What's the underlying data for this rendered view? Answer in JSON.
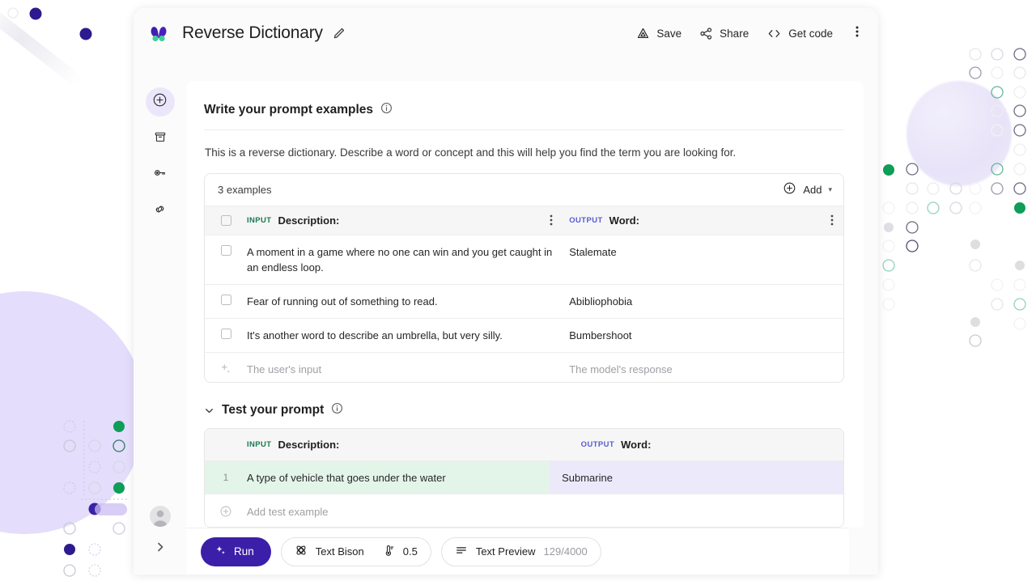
{
  "app": {
    "logo_icon": "butterfly-logo",
    "title": "Reverse Dictionary",
    "edit_icon": "pencil-icon"
  },
  "topbar": {
    "actions": [
      {
        "label": "Save",
        "icon": "drive-save-icon"
      },
      {
        "label": "Share",
        "icon": "share-icon"
      },
      {
        "label": "Get code",
        "icon": "code-brackets-icon"
      }
    ],
    "overflow_icon": "more-vertical-icon"
  },
  "sidebar": {
    "items": [
      {
        "name": "create-new-prompt",
        "icon": "plus-circle-icon",
        "active": true
      },
      {
        "name": "saved-prompts",
        "icon": "archive-box-icon",
        "active": false
      },
      {
        "name": "api-key",
        "icon": "key-icon",
        "active": false
      },
      {
        "name": "links",
        "icon": "link-icon",
        "active": false
      }
    ],
    "avatar_icon": "user-avatar",
    "expand_icon": "chevron-right-icon"
  },
  "prompt_section": {
    "title": "Write your prompt examples",
    "info_icon": "info-icon",
    "description": "This is a reverse dictionary. Describe a word or concept and this will help you find the term you are looking for.",
    "examples_count_label": "3 examples",
    "add_label": "Add",
    "add_icon": "plus-circle-icon",
    "add_caret_icon": "caret-down-icon",
    "columns": {
      "input_tag": "INPUT",
      "input_label": "Description:",
      "output_tag": "OUTPUT",
      "output_label": "Word:"
    },
    "rows": [
      {
        "input": "A moment in a game where no one can win and you get caught in an endless loop.",
        "output": "Stalemate"
      },
      {
        "input": "Fear of running out of something to read.",
        "output": "Abibliophobia"
      },
      {
        "input": "It's another word to describe an umbrella, but very silly.",
        "output": "Bumbershoot"
      }
    ],
    "placeholder_row": {
      "icon": "sparkle-add-icon",
      "input": "The user's input",
      "output": "The model's response"
    },
    "row_menu_icon": "more-vertical-icon",
    "checkbox_icon": "checkbox-unchecked"
  },
  "test_section": {
    "collapse_icon": "chevron-down-icon",
    "title": "Test your prompt",
    "info_icon": "info-icon",
    "columns": {
      "input_tag": "INPUT",
      "input_label": "Description:",
      "output_tag": "OUTPUT",
      "output_label": "Word:"
    },
    "rows": [
      {
        "num": "1",
        "input": "A type of vehicle that goes under the water",
        "output": "Submarine"
      }
    ],
    "add_test_label": "Add test example",
    "add_test_icon": "plus-circle-icon"
  },
  "toolbar": {
    "run_label": "Run",
    "run_icon": "sparkle-icon",
    "model_icon": "atom-icon",
    "model_label": "Text Bison",
    "temperature_icon": "thermometer-icon",
    "temperature_value": "0.5",
    "preview_icon": "lines-icon",
    "preview_label": "Text Preview",
    "token_count": "129/4000"
  },
  "colors": {
    "accent_purple": "#3c1fa8",
    "input_tag_green": "#18794e",
    "output_tag_purple": "#5a5ad1",
    "test_input_bg": "#e3f5e9",
    "test_output_bg": "#eceafa",
    "decor_green": "#0f9d58",
    "decor_purple": "#3c1fa8",
    "decor_lilac": "#e4ddfb"
  }
}
